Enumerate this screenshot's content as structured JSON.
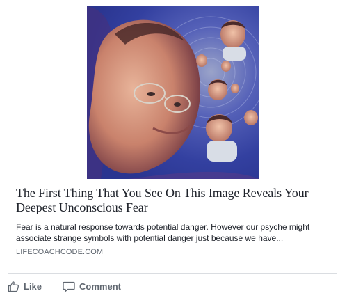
{
  "post": {
    "image_alt_icon": "image-icon",
    "link": {
      "title": "The First Thing That You See On This Image Reveals Your Deepest Unconscious Fear",
      "description": "Fear is a natural response towards potential danger. However our psyche might associate strange symbols with potential danger just because we have...",
      "domain": "LIFECOACHCODE.COM"
    },
    "actions": {
      "like_label": "Like",
      "comment_label": "Comment"
    }
  },
  "colors": {
    "text": "#1d2129",
    "muted": "#606770",
    "border": "#dddfe2",
    "image_background": "#3b4aa8"
  }
}
